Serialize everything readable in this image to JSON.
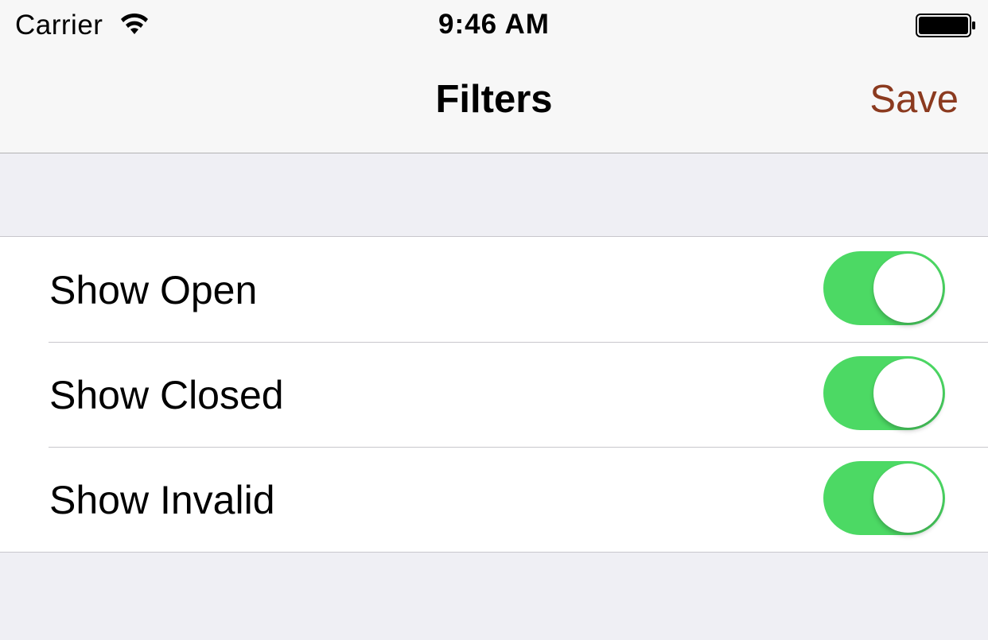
{
  "status_bar": {
    "carrier": "Carrier",
    "time": "9:46 AM",
    "wifi_icon": "wifi-icon",
    "battery_icon": "battery-full-icon"
  },
  "nav": {
    "title": "Filters",
    "save_label": "Save",
    "accent_color": "#8b3a1f"
  },
  "filters": [
    {
      "label": "Show Open",
      "enabled": true
    },
    {
      "label": "Show Closed",
      "enabled": true
    },
    {
      "label": "Show Invalid",
      "enabled": true
    }
  ],
  "colors": {
    "switch_on": "#4cd964",
    "background": "#efeff4"
  }
}
